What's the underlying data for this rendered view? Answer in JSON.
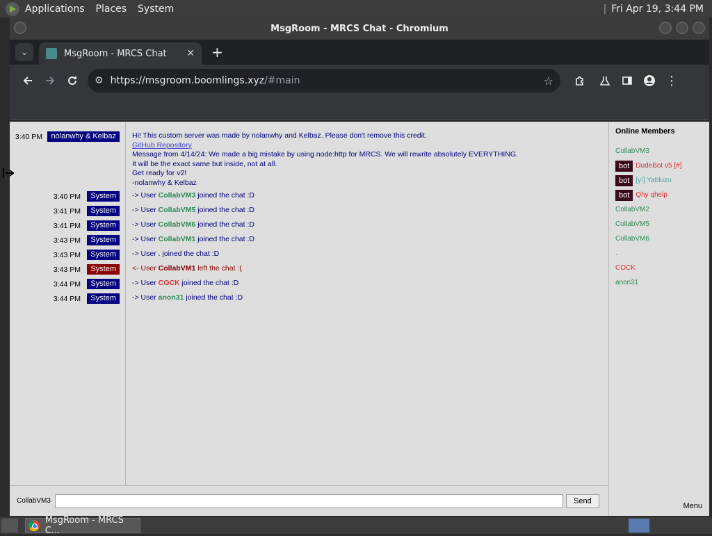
{
  "top_panel": {
    "menus": [
      "Applications",
      "Places",
      "System"
    ],
    "clock": "Fri Apr 19,  3:44 PM"
  },
  "window": {
    "title": "MsgRoom - MRCS Chat - Chromium"
  },
  "tabs": [
    {
      "label": "MsgRoom - MRCS Chat",
      "close": "✕"
    }
  ],
  "toolbar": {
    "url_host": "https://msgroom.boomlings.xyz",
    "url_path": "/#main"
  },
  "chat": {
    "first": {
      "time": "3:40 PM",
      "author": "nolanwhy & Kelbaz",
      "lines": [
        "Hi! This custom server was made by nolanwhy and Kelbaz. Please don't remove this credit.",
        "GitHub Repository ",
        "Message from 4/14/24: We made a big mistake by using node:http for MRCS. We will rewrite absolutely EVERYTHING.",
        "It will be the exact same but inside, not at all.",
        "Get ready for v2!",
        "-nolanwhy & Kelbaz"
      ]
    },
    "events": [
      {
        "time": "3:40 PM",
        "badge": "System",
        "prefix": "-> User ",
        "user": "CollabVM3",
        "suffix": " joined the chat :D",
        "badge_color": "#000080",
        "user_color": "#2e8b57",
        "text_color": "#000080"
      },
      {
        "time": "3:41 PM",
        "badge": "System",
        "prefix": "-> User ",
        "user": "CollabVM5",
        "suffix": " joined the chat :D",
        "badge_color": "#000080",
        "user_color": "#2e8b57",
        "text_color": "#000080"
      },
      {
        "time": "3:41 PM",
        "badge": "System",
        "prefix": "-> User ",
        "user": "CollabVM6",
        "suffix": " joined the chat :D",
        "badge_color": "#000080",
        "user_color": "#2e8b57",
        "text_color": "#000080"
      },
      {
        "time": "3:43 PM",
        "badge": "System",
        "prefix": "-> User ",
        "user": "CollabVM1",
        "suffix": " joined the chat :D",
        "badge_color": "#000080",
        "user_color": "#2e8b57",
        "text_color": "#000080"
      },
      {
        "time": "3:43 PM",
        "badge": "System",
        "prefix": "-> User ",
        "user": ".",
        "suffix": " joined the chat :D",
        "badge_color": "#000080",
        "user_color": "#2e8b57",
        "text_color": "#000080"
      },
      {
        "time": "3:43 PM",
        "badge": "System",
        "prefix": "<- User ",
        "user": "CollabVM1",
        "suffix": " left the chat :(",
        "badge_color": "#8b0000",
        "user_color": "#8b0000",
        "text_color": "#8b0000"
      },
      {
        "time": "3:44 PM",
        "badge": "System",
        "prefix": "-> User ",
        "user": "COCK",
        "suffix": " joined the chat :D",
        "badge_color": "#000080",
        "user_color": "#e03030",
        "text_color": "#000080"
      },
      {
        "time": "3:44 PM",
        "badge": "System",
        "prefix": "-> User ",
        "user": "anon31",
        "suffix": " joined the chat :D",
        "badge_color": "#000080",
        "user_color": "#2e8b57",
        "text_color": "#000080"
      }
    ]
  },
  "members": {
    "title": "Online Members",
    "list": [
      {
        "name": "CollabVM3",
        "bot": "",
        "color": "#2e8b57"
      },
      {
        "name": "DudeBot v5 [#]",
        "bot": "bot",
        "color": "#e03030"
      },
      {
        "name": "[y!] Yabluzo",
        "bot": "bot",
        "color": "#4aa3a3"
      },
      {
        "name": "Qhy   qhelp",
        "bot": "bot",
        "color": "#e03030"
      },
      {
        "name": "CollabVM2",
        "bot": "",
        "color": "#2e8b57"
      },
      {
        "name": "CollabVM5",
        "bot": "",
        "color": "#2e8b57"
      },
      {
        "name": "CollabVM6",
        "bot": "",
        "color": "#2e8b57"
      },
      {
        "name": ".",
        "bot": "",
        "color": "#2e8b57"
      },
      {
        "name": "COCK",
        "bot": "",
        "color": "#e03030"
      },
      {
        "name": "anon31",
        "bot": "",
        "color": "#2e8b57"
      }
    ]
  },
  "input": {
    "nick": "CollabVM3",
    "value": "",
    "send_label": "Send",
    "menu_label": "Menu"
  },
  "taskbar": {
    "item_label": "MsgRoom - MRCS C..."
  }
}
